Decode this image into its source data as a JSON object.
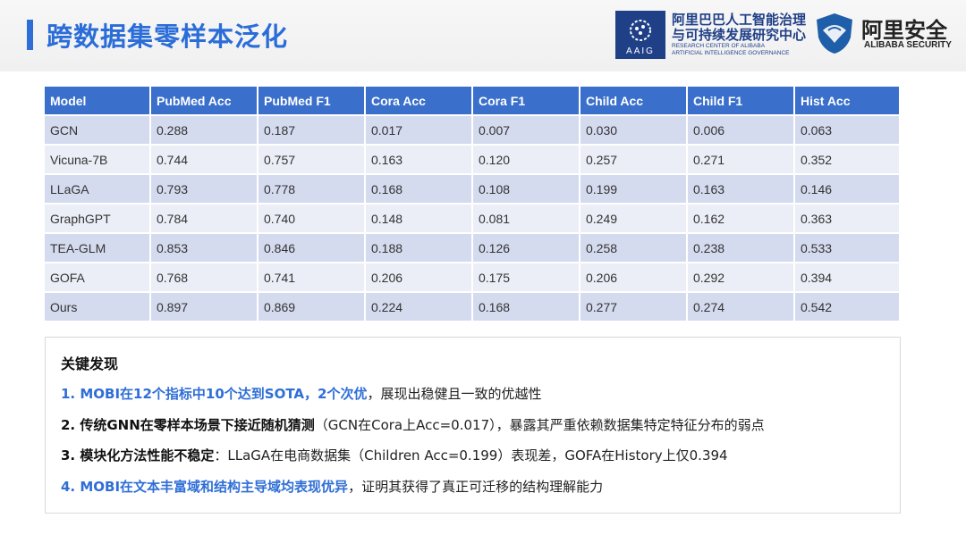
{
  "header": {
    "title": "跨数据集零样本泛化",
    "aaig": {
      "abbr": "AAIG",
      "cn_line1": "阿里巴巴人工智能治理",
      "cn_line2": "与可持续发展研究中心",
      "en_line1": "RESEARCH CENTER OF ALIBABA",
      "en_line2": "ARTIFICIAL INTELLIGENCE GOVERNANCE"
    },
    "security": {
      "cn": "阿里安全",
      "en": "ALIBABA SECURITY"
    }
  },
  "table": {
    "columns": [
      "Model",
      "PubMed Acc",
      "PubMed F1",
      "Cora Acc",
      "Cora F1",
      "Child Acc",
      "Child F1",
      "Hist Acc"
    ],
    "rows": [
      [
        "GCN",
        "0.288",
        "0.187",
        "0.017",
        "0.007",
        "0.030",
        "0.006",
        "0.063"
      ],
      [
        "Vicuna-7B",
        "0.744",
        "0.757",
        "0.163",
        "0.120",
        "0.257",
        "0.271",
        "0.352"
      ],
      [
        "LLaGA",
        "0.793",
        "0.778",
        "0.168",
        "0.108",
        "0.199",
        "0.163",
        "0.146"
      ],
      [
        "GraphGPT",
        "0.784",
        "0.740",
        "0.148",
        "0.081",
        "0.249",
        "0.162",
        "0.363"
      ],
      [
        "TEA-GLM",
        "0.853",
        "0.846",
        "0.188",
        "0.126",
        "0.258",
        "0.238",
        "0.533"
      ],
      [
        "GOFA",
        "0.768",
        "0.741",
        "0.206",
        "0.175",
        "0.206",
        "0.292",
        "0.394"
      ],
      [
        "Ours",
        "0.897",
        "0.869",
        "0.224",
        "0.168",
        "0.277",
        "0.274",
        "0.542"
      ]
    ]
  },
  "findings": {
    "title": "关键发现",
    "items": [
      {
        "lead": "1. MOBI在12个指标中10个达到SOTA，2个次优",
        "rest": "，展现出稳健且一致的优越性",
        "color": "#2e6ed6"
      },
      {
        "lead": "2. 传统GNN在零样本场景下接近随机猜测",
        "rest": "（GCN在Cora上Acc=0.017），暴露其严重依赖数据集特定特征分布的弱点",
        "color": "#111111"
      },
      {
        "lead": "3. 模块化方法性能不稳定",
        "rest": "：LLaGA在电商数据集（Children Acc=0.199）表现差，GOFA在History上仅0.394",
        "color": "#111111"
      },
      {
        "lead": "4. MOBI在文本丰富域和结构主导域均表现优异",
        "rest": "，证明其获得了真正可迁移的结构理解能力",
        "color": "#2e6ed6"
      }
    ]
  }
}
